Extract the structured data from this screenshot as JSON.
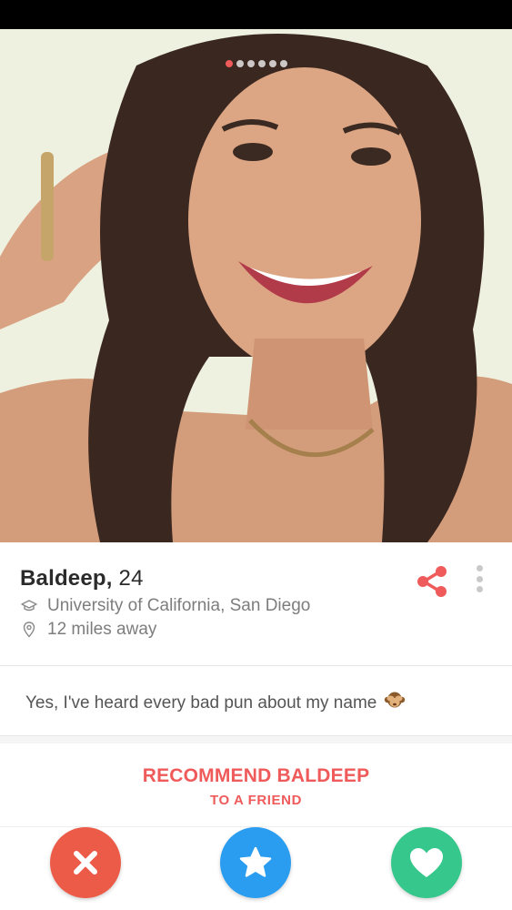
{
  "profile": {
    "name": "Baldeep,",
    "age": "24",
    "school": "University of California, San Diego",
    "distance": "12 miles away",
    "bio": "Yes, I've heard every bad pun about my name",
    "bio_emoji": "see-no-evil-monkey-emoji"
  },
  "photo": {
    "count": 6,
    "active_index": 0
  },
  "recommend": {
    "line1": "RECOMMEND BALDEEP",
    "line2": "TO A FRIEND"
  },
  "icons": {
    "school": "graduation-cap-icon",
    "distance": "location-pin-icon",
    "share": "share-icon",
    "more": "more-vertical-icon",
    "nope": "close-icon",
    "super_like": "star-icon",
    "like": "heart-icon"
  },
  "colors": {
    "accent": "#ef5a5a",
    "nope": "#ec5b48",
    "super_like": "#2b9df0",
    "like": "#35c78b",
    "text_primary": "#2b2b2b",
    "text_secondary": "#7d7d7d"
  }
}
